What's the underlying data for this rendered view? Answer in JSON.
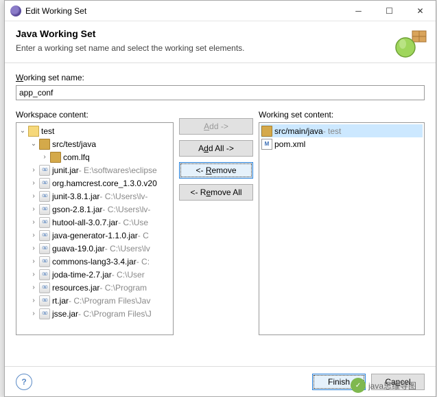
{
  "window": {
    "title": "Edit Working Set"
  },
  "header": {
    "title": "Java Working Set",
    "subtitle": "Enter a working set name and select the working set elements."
  },
  "labels": {
    "name": "Working set name:",
    "workspace": "Workspace content:",
    "content": "Working set content:"
  },
  "input": {
    "name": "app_conf"
  },
  "buttons": {
    "add": "Add ->",
    "addAll": "Add All ->",
    "remove": "<- Remove",
    "removeAll": "<- Remove All",
    "finish": "Finish",
    "cancel": "Cancel"
  },
  "tree": {
    "root": "test",
    "srcTest": "src/test/java",
    "pkg": "com.lfq",
    "jars": [
      {
        "name": "junit.jar",
        "loc": " - E:\\softwares\\eclipse"
      },
      {
        "name": "org.hamcrest.core_1.3.0.v20"
      },
      {
        "name": "junit-3.8.1.jar",
        "loc": " - C:\\Users\\lv-"
      },
      {
        "name": "gson-2.8.1.jar",
        "loc": " - C:\\Users\\lv-"
      },
      {
        "name": "hutool-all-3.0.7.jar",
        "loc": " - C:\\Use"
      },
      {
        "name": "java-generator-1.1.0.jar",
        "loc": " - C"
      },
      {
        "name": "guava-19.0.jar",
        "loc": " - C:\\Users\\lv"
      },
      {
        "name": "commons-lang3-3.4.jar",
        "loc": " - C:"
      },
      {
        "name": "joda-time-2.7.jar",
        "loc": " - C:\\User"
      },
      {
        "name": "resources.jar",
        "loc": " - C:\\Program"
      },
      {
        "name": "rt.jar",
        "loc": " - C:\\Program Files\\Jav"
      },
      {
        "name": "jsse.jar",
        "loc": " - C:\\Program Files\\J"
      }
    ]
  },
  "selected": [
    {
      "icon": "src",
      "name": "src/main/java",
      "loc": " - test"
    },
    {
      "icon": "xml",
      "name": "pom.xml"
    }
  ],
  "watermark": "java思维导图"
}
